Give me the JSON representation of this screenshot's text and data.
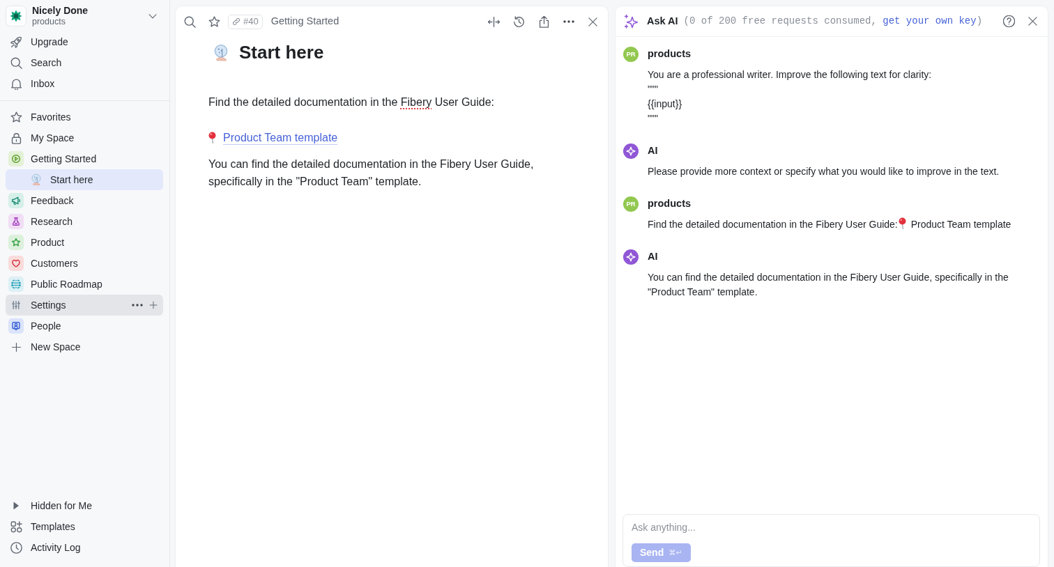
{
  "sidebar": {
    "workspace": {
      "name": "Nicely Done",
      "subtitle": "products"
    },
    "nav": [
      {
        "label": "Upgrade"
      },
      {
        "label": "Search"
      },
      {
        "label": "Inbox"
      }
    ],
    "spaces": [
      {
        "label": "Favorites",
        "selected": false,
        "hovered": false
      },
      {
        "label": "My Space",
        "selected": false,
        "hovered": false
      },
      {
        "label": "Getting Started",
        "selected": false,
        "hovered": false,
        "children": [
          {
            "label": "Start here",
            "selected": true,
            "hovered": false
          }
        ]
      },
      {
        "label": "Feedback",
        "selected": false,
        "hovered": false
      },
      {
        "label": "Research",
        "selected": false,
        "hovered": false
      },
      {
        "label": "Product",
        "selected": false,
        "hovered": false
      },
      {
        "label": "Customers",
        "selected": false,
        "hovered": false
      },
      {
        "label": "Public Roadmap",
        "selected": false,
        "hovered": false
      },
      {
        "label": "Settings",
        "selected": false,
        "hovered": true
      },
      {
        "label": "People",
        "selected": false,
        "hovered": false
      }
    ],
    "new_space": {
      "label": "New Space"
    },
    "hidden_section": {
      "label": "Hidden for Me",
      "expanded": false
    },
    "footer": [
      {
        "label": "Templates"
      },
      {
        "label": "Activity Log"
      }
    ]
  },
  "document": {
    "id_badge": "#40",
    "breadcrumb": "Getting Started",
    "title": "Start here",
    "blocks": [
      {
        "kind": "paragraph",
        "segments": [
          {
            "kind": "text",
            "text": "Find the detailed documentation in the "
          },
          {
            "kind": "misspelled",
            "text": "Fibery"
          },
          {
            "kind": "text",
            "text": " User Guide:"
          }
        ]
      },
      {
        "kind": "link",
        "text": "Product Team template"
      },
      {
        "kind": "paragraph",
        "segments": [
          {
            "kind": "text",
            "text": "You can find the detailed documentation in the Fibery User Guide, specifically in the \"Product Team\" template."
          }
        ]
      }
    ]
  },
  "ai_panel": {
    "title": "Ask AI",
    "usage": {
      "before": "(0 of 200 free requests consumed, ",
      "link": "get your own key",
      "after": ")"
    },
    "messages": [
      {
        "kind": "user",
        "author": "products",
        "initials": "PR",
        "segments": [
          {
            "kind": "text",
            "text": "You are a professional writer. Improve the following text for clarity:\n\"\"\"\n{{input}}\n\"\"\""
          }
        ]
      },
      {
        "kind": "ai",
        "author": "AI",
        "segments": [
          {
            "kind": "text",
            "text": "Please provide more context or specify what you would like to improve in the text."
          }
        ]
      },
      {
        "kind": "user",
        "author": "products",
        "initials": "PR",
        "segments": [
          {
            "kind": "text",
            "text": "Find the detailed documentation in the Fibery User Guide:"
          },
          {
            "kind": "pin"
          },
          {
            "kind": "text",
            "text": " Product Team template"
          }
        ]
      },
      {
        "kind": "ai",
        "author": "AI",
        "segments": [
          {
            "kind": "text",
            "text": "You can find the detailed documentation in the Fibery User Guide, specifically in the \"Product Team\" template."
          }
        ]
      }
    ],
    "composer": {
      "placeholder": "Ask anything...",
      "send": {
        "label": "Send",
        "shortcut": "⌘↵",
        "disabled": true
      }
    }
  }
}
